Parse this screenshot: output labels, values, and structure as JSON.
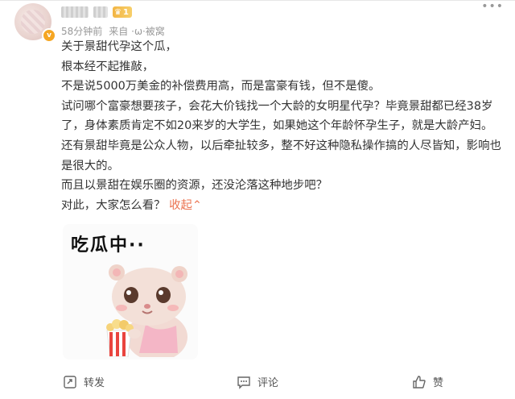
{
  "header": {
    "level_badge": "1",
    "verify_mark": "v",
    "more_icon": "ellipsis-icon",
    "time_text": "58分钟前",
    "source_text": "来自",
    "source_suffix": "·ω·被窝"
  },
  "post": {
    "lines": [
      "关于景甜代孕这个瓜，",
      "根本经不起推敲，",
      "不是说5000万美金的补偿费用高，而是富豪有钱，但不是傻。",
      "试问哪个富豪想要孩子，会花大价钱找一个大龄的女明星代孕？毕竟景甜都已经38岁了，身体素质肯定不如20来岁的大学生，如果她这个年龄怀孕生子，就是大龄产妇。",
      "还有景甜毕竟是公众人物，以后牵扯较多，整不好这种隐私操作搞的人尽皆知，影响也是很大的。",
      "而且以景甜在娱乐圈的资源，还没沦落这种地步吧？"
    ],
    "last_line": "对此，大家怎么看？",
    "collapse_label": "收起",
    "collapse_icon": "chevron-up-icon"
  },
  "sticker": {
    "text": "吃瓜中··"
  },
  "actions": {
    "repost_label": "转发",
    "comment_label": "评论",
    "like_label": "赞"
  },
  "colors": {
    "accent": "#eb7350",
    "badge": "#f2b544",
    "meta": "#999999"
  }
}
